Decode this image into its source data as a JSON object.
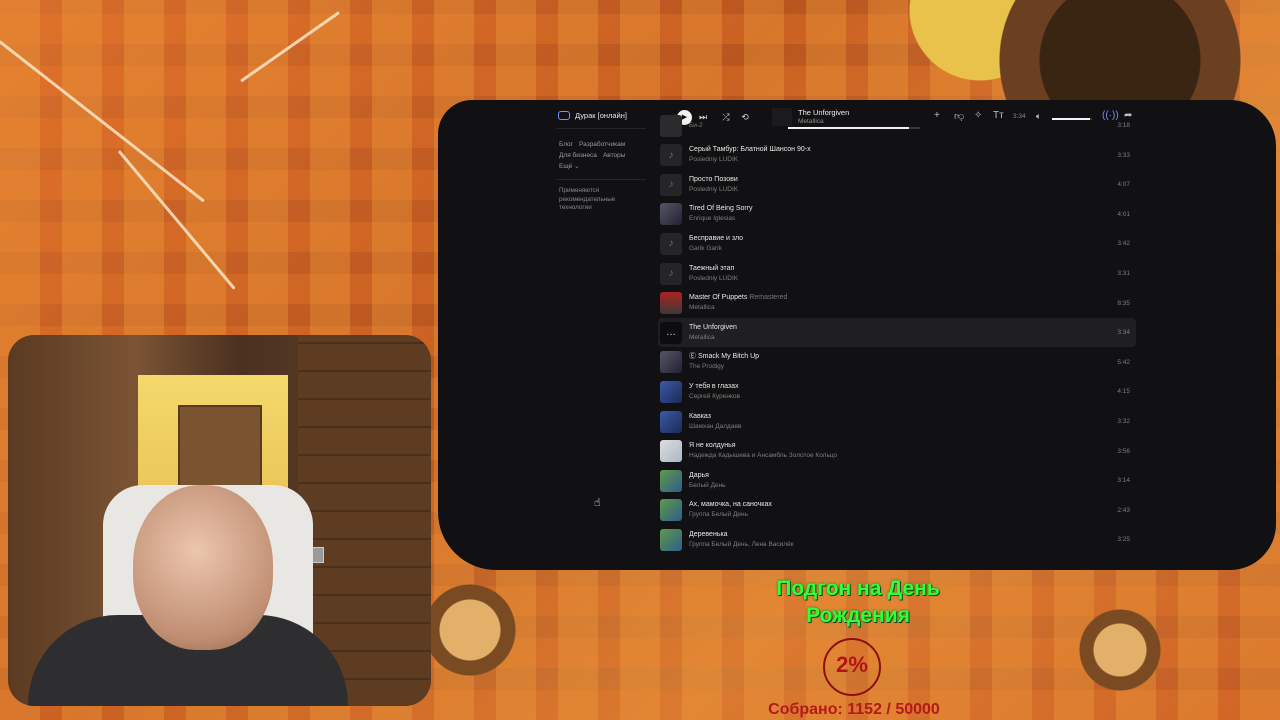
{
  "nav": {
    "logo_label": "Дурак [онлайн]",
    "links_row1": [
      "Блог",
      "Разработчикам"
    ],
    "links_row2": [
      "Для бизнеса",
      "Авторы"
    ],
    "more": "Ещё ⌄",
    "note": "Применяются рекомендательные технологии"
  },
  "player": {
    "track_title": "The Unforgiven",
    "track_artist": "Metallica",
    "time": "3:34",
    "progress": 0.92,
    "volume": 0.95
  },
  "tracks": [
    {
      "title": "",
      "version": "",
      "artist": "Би-2",
      "duration": "3:18",
      "cover": "dark"
    },
    {
      "title": "Серый Тамбур: Блатной Шансон 90-х",
      "version": "",
      "artist": "Posledniy LUDIK",
      "duration": "3:33",
      "cover": "note"
    },
    {
      "title": "Просто Позови",
      "version": "",
      "artist": "Posledniy LUDIK",
      "duration": "4:07",
      "cover": "note"
    },
    {
      "title": "Tired Of Being Sorry",
      "version": "",
      "artist": "Enrique Iglesias",
      "duration": "4:01",
      "cover": "photo"
    },
    {
      "title": "Бесправие и зло",
      "version": "",
      "artist": "Garik Garik",
      "duration": "3:42",
      "cover": "note"
    },
    {
      "title": "Таежный этап",
      "version": "",
      "artist": "Posledniy LUDIK",
      "duration": "3:31",
      "cover": "note"
    },
    {
      "title": "Master Of Puppets",
      "version": "Remastered",
      "artist": "Metallica",
      "duration": "8:35",
      "cover": "red"
    },
    {
      "title": "The Unforgiven",
      "version": "",
      "artist": "Metallica",
      "duration": "3:34",
      "cover": "dots"
    },
    {
      "title": "Ⓔ Smack My Bitch Up",
      "version": "",
      "artist": "The Prodigy",
      "duration": "5:42",
      "cover": "photo"
    },
    {
      "title": "У тебя в глазах",
      "version": "",
      "artist": "Сергей Куренков",
      "duration": "4:15",
      "cover": "blue"
    },
    {
      "title": "Кавказ",
      "version": "",
      "artist": "Шамхан Далдаев",
      "duration": "3:32",
      "cover": "blue"
    },
    {
      "title": "Я не колдунья",
      "version": "",
      "artist": "Надежда Кадышева и Ансамбль Золотое Кольцо",
      "duration": "3:56",
      "cover": "light"
    },
    {
      "title": "Дарья",
      "version": "",
      "artist": "Белый День",
      "duration": "3:14",
      "cover": "green"
    },
    {
      "title": "Ах, мамочка, на саночках",
      "version": "",
      "artist": "Группа Белый День",
      "duration": "2:43",
      "cover": "green"
    },
    {
      "title": "Деревенька",
      "version": "",
      "artist": "Группа Белый День, Лена Василёк",
      "duration": "3:25",
      "cover": "green"
    }
  ],
  "active_index": 7,
  "donation": {
    "title": "Подгон на День Рождения",
    "percent": "2%",
    "collected": "Собрано: 1152 / 50000"
  },
  "colors": {
    "app_bg": "#111113",
    "goal_green": "#33ff33",
    "goal_red": "#b51a1a"
  },
  "icons": [
    "gamepad-icon",
    "prev-icon",
    "play-icon",
    "next-icon",
    "shuffle-icon",
    "repeat-icon",
    "plus-icon",
    "dislike-icon",
    "sparkle-icon",
    "text-icon",
    "volume-icon",
    "broadcast-icon",
    "share-icon",
    "music-note-icon"
  ]
}
